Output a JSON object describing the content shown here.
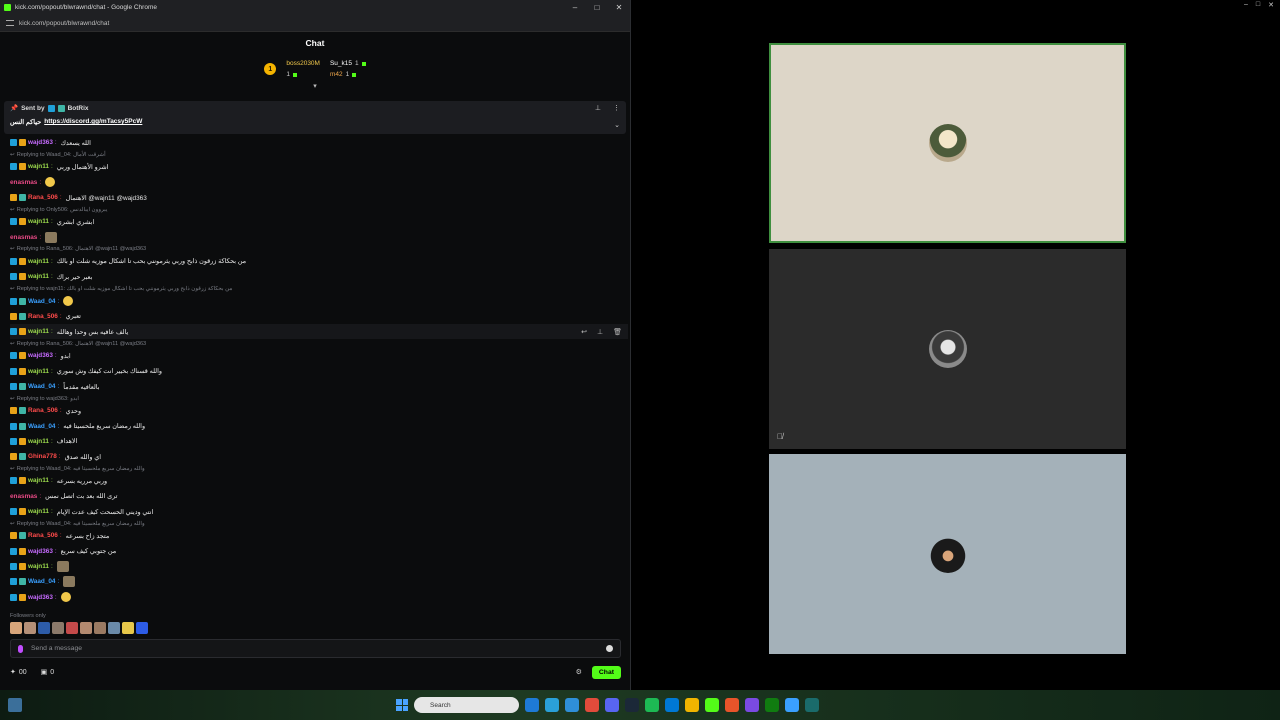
{
  "window": {
    "title": "kick.com/popout/blwrawnd/chat - Google Chrome",
    "url": "kick.com/popout/blwrawnd/chat"
  },
  "chat": {
    "header": "Chat",
    "gifters": [
      {
        "name": "boss2030M",
        "count": "1"
      },
      {
        "name": "Su_k15",
        "count": "1"
      },
      {
        "name": "m42",
        "count": "1"
      }
    ],
    "gifter_rank": "1",
    "pinned": {
      "sent_by_label": "Sent by",
      "sender": "BotRix",
      "prefix": "حياكم النس",
      "link": "https://discord.gg/mTacsy5PcW"
    },
    "messages": [
      {
        "reply": "",
        "user": "wajd363",
        "color": "u-purple",
        "text": "الله يسعدك",
        "badges": [
          "mod",
          "sub"
        ]
      },
      {
        "reply": "Replying to Waad_04: أشرقت الأمال",
        "user": "",
        "color": "",
        "text": "",
        "badges": []
      },
      {
        "reply": "",
        "user": "wajn11",
        "color": "u-green",
        "text": "اشرو الأهتمال وربي",
        "badges": [
          "mod",
          "sub"
        ]
      },
      {
        "reply": "",
        "user": "enasmas",
        "color": "u-pink",
        "text": "",
        "badges": []
      },
      {
        "reply": "",
        "user": "Rana_506",
        "color": "u-red",
        "text": "الاهتمال @wajn11 @wajd363",
        "badges": [
          "sub",
          "gift"
        ]
      },
      {
        "reply": "Replying to Only506: يبروون ايبالدنس",
        "user": "",
        "color": "",
        "text": "",
        "badges": []
      },
      {
        "reply": "",
        "user": "wajn11",
        "color": "u-green",
        "text": "ابشري ابشري",
        "badges": [
          "mod",
          "sub"
        ]
      },
      {
        "reply": "",
        "user": "enasmas",
        "color": "u-pink",
        "text": "",
        "badges": []
      },
      {
        "reply": "Replying to Rana_506: الاهتمال @wajn11 @wajd363",
        "user": "",
        "color": "",
        "text": "",
        "badges": []
      },
      {
        "reply": "",
        "user": "wajn11",
        "color": "u-green",
        "text": "من بحكاكة زرقون ذابح وربي يثرمونني بحب تا اشكال موزيه شلت او بالك",
        "badges": [
          "mod",
          "sub"
        ]
      },
      {
        "reply": "",
        "user": "wajn11",
        "color": "u-green",
        "text": "بعبر حير براك",
        "badges": [
          "mod",
          "sub"
        ]
      },
      {
        "reply": "Replying to wajn11: من بحكاكة زرقون ذابح وربي يثرمونني بحب تا اشكال موزيه شلت او بالك",
        "user": "",
        "color": "",
        "text": "",
        "badges": []
      },
      {
        "reply": "",
        "user": "Waad_04",
        "color": "u-blue",
        "text": "",
        "badges": [
          "mod",
          "gift"
        ]
      },
      {
        "reply": "",
        "user": "Rana_506",
        "color": "u-red",
        "text": "تعبري",
        "badges": [
          "sub",
          "gift"
        ]
      },
      {
        "reply": "",
        "user": "wajn11",
        "color": "u-green",
        "text": "يالف عافيه بس وحدا وهالله",
        "badges": [
          "mod",
          "sub"
        ],
        "hover": true
      },
      {
        "reply": "Replying to Rana_506: الاهتمال @wajn11 @wajd363",
        "user": "",
        "color": "",
        "text": "",
        "badges": []
      },
      {
        "reply": "",
        "user": "wajd363",
        "color": "u-purple",
        "text": "ابدو",
        "badges": [
          "mod",
          "sub"
        ]
      },
      {
        "reply": "",
        "user": "wajn11",
        "color": "u-green",
        "text": "والله قسناك بخيير انت كيفك وش سوري",
        "badges": [
          "mod",
          "sub"
        ]
      },
      {
        "reply": "",
        "user": "Waad_04",
        "color": "u-blue",
        "text": "بالعافيه مقدماً",
        "badges": [
          "mod",
          "gift"
        ]
      },
      {
        "reply": "Replying to wajd363: ابدو",
        "user": "",
        "color": "",
        "text": "",
        "badges": []
      },
      {
        "reply": "",
        "user": "Rana_506",
        "color": "u-red",
        "text": "وحدي",
        "badges": [
          "sub",
          "gift"
        ]
      },
      {
        "reply": "",
        "user": "Waad_04",
        "color": "u-blue",
        "text": "والله رمضان سريع ملحسيتا فيه",
        "badges": [
          "mod",
          "gift"
        ]
      },
      {
        "reply": "",
        "user": "wajn11",
        "color": "u-green",
        "text": "الاهداف",
        "badges": [
          "mod",
          "sub"
        ]
      },
      {
        "reply": "",
        "user": "Ghina778",
        "color": "u-red",
        "text": "اي والله صدق",
        "badges": [
          "sub",
          "gift"
        ]
      },
      {
        "reply": "Replying to Waad_04: والله رمضان سريع ملحسيتا فيه",
        "user": "",
        "color": "",
        "text": "",
        "badges": []
      },
      {
        "reply": "",
        "user": "wajn11",
        "color": "u-green",
        "text": "وربي مرريه بسرعه",
        "badges": [
          "mod",
          "sub"
        ]
      },
      {
        "reply": "",
        "user": "enasmas",
        "color": "u-pink",
        "text": "ترى الله بعد بت اتصل نمس",
        "badges": []
      },
      {
        "reply": "",
        "user": "wajn11",
        "color": "u-green",
        "text": "انتي وديني الحسحت كيف عدت الإيام",
        "badges": [
          "mod",
          "sub"
        ]
      },
      {
        "reply": "Replying to Waad_04: والله رمضان سريع ملحسيتا فيه",
        "user": "",
        "color": "",
        "text": "",
        "badges": []
      },
      {
        "reply": "",
        "user": "Rana_506",
        "color": "u-red",
        "text": "متجد زاح بسرعه",
        "badges": [
          "sub",
          "gift"
        ]
      },
      {
        "reply": "",
        "user": "wajd363",
        "color": "u-purple",
        "text": "من جتوبي كيف سريع",
        "badges": [
          "mod",
          "sub"
        ]
      },
      {
        "reply": "",
        "user": "wajn11",
        "color": "u-green",
        "text": "",
        "badges": [
          "mod",
          "sub"
        ]
      },
      {
        "reply": "",
        "user": "Waad_04",
        "color": "u-blue",
        "text": "",
        "badges": [
          "mod",
          "gift"
        ]
      },
      {
        "reply": "",
        "user": "wajd363",
        "color": "u-purple",
        "text": "",
        "badges": [
          "mod",
          "sub"
        ]
      }
    ],
    "followers_only": "Followers only",
    "input_placeholder": "Send a message",
    "stats": {
      "viewers": "00",
      "bits": "0"
    },
    "send_button": "Chat"
  },
  "taskbar": {
    "search_placeholder": "Search"
  },
  "colors": {
    "kick_green": "#53fc18",
    "background": "#0b0c0d",
    "active_tile_border": "#3f8f3f"
  }
}
